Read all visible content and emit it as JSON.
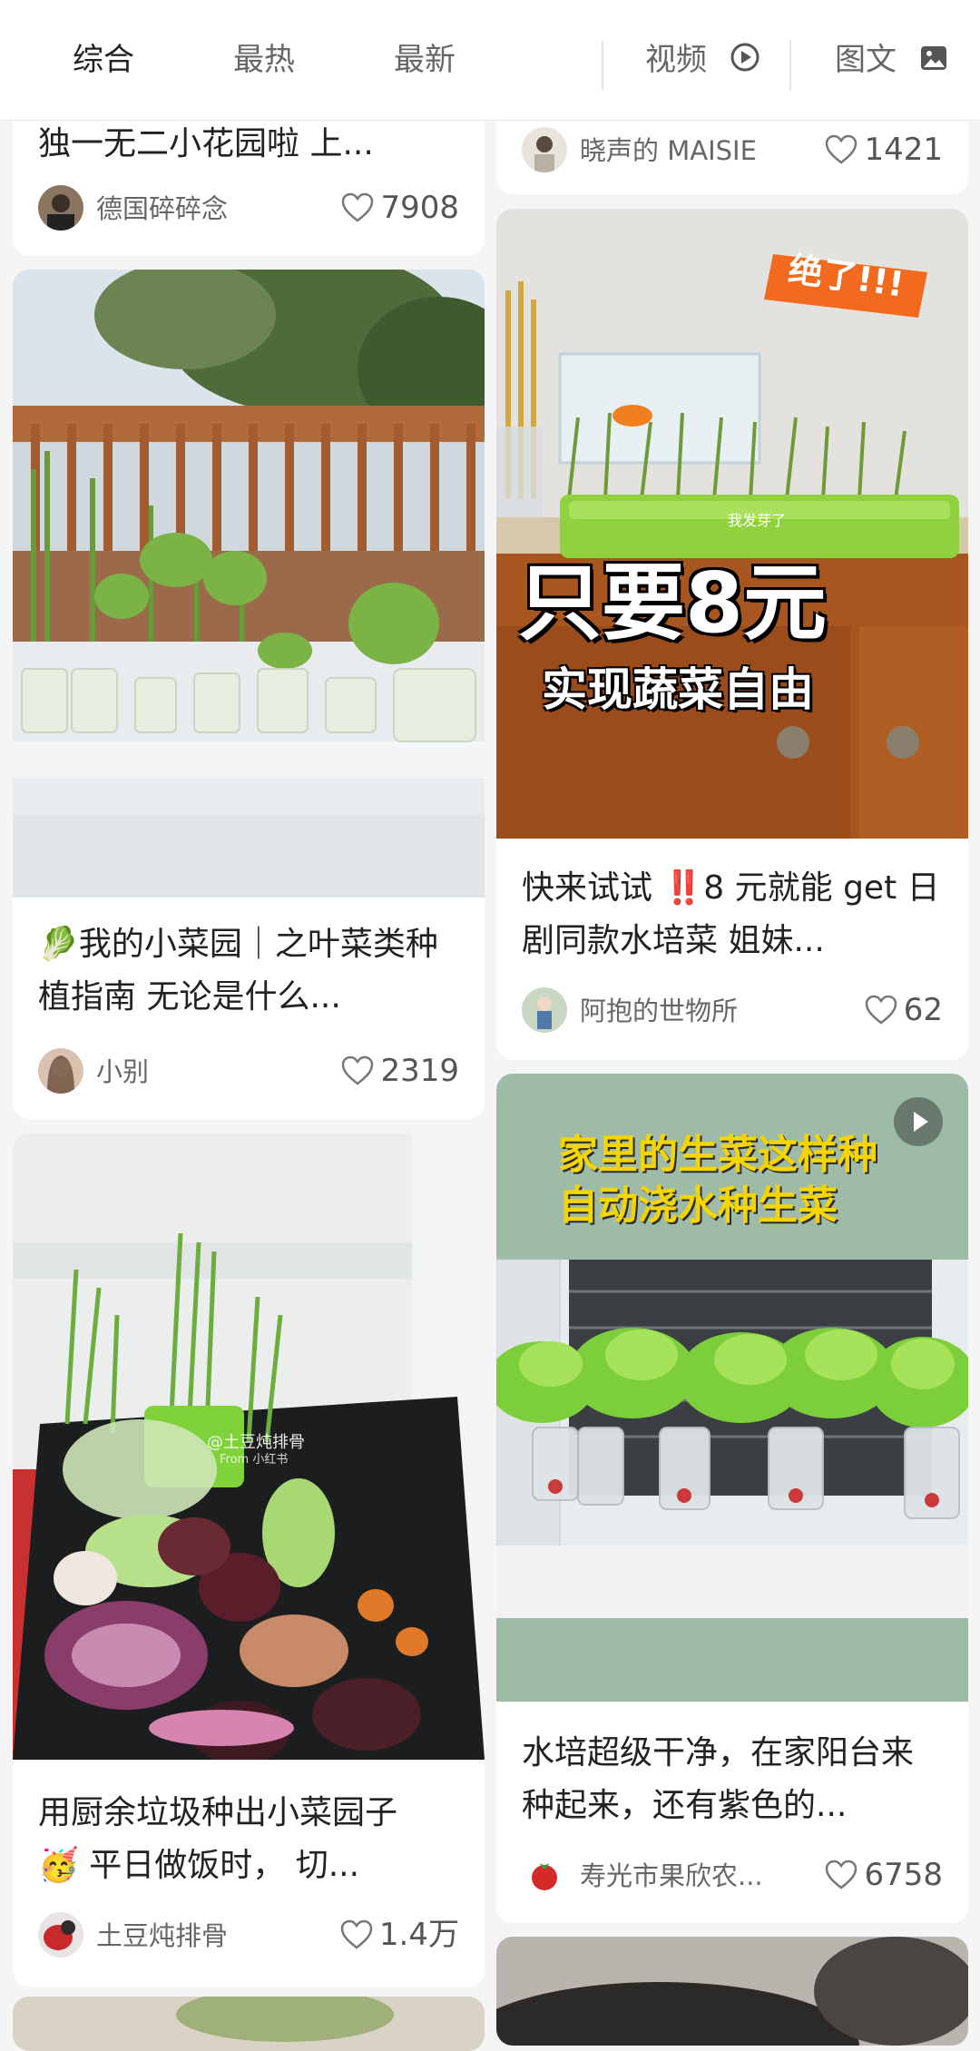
{
  "header": {
    "tabs": [
      "综合",
      "最热",
      "最新"
    ],
    "video_tab": "视频",
    "image_text_tab": "图文"
  },
  "cards": [
    {
      "title": "独一无二小花园啦 上...",
      "author": "德国碎碎念",
      "likes": "7908"
    },
    {
      "title": "",
      "author": "晓声的 MAISIE",
      "likes": "1421"
    },
    {
      "title": "我的小菜园｜之叶菜类种植指南 无论是什么...",
      "emoji": "🥬",
      "author": "小别",
      "likes": "2319"
    },
    {
      "title": "快来试试",
      "title2": "‼️8 元就能 get 日剧同款水培菜 姐妹...",
      "author": "阿抱的世物所",
      "likes": "62",
      "image_text": {
        "tag": "绝了!!!",
        "big": "只要8元",
        "sub": "实现蔬菜自由",
        "small": "我发芽了"
      }
    },
    {
      "title": "用厨余垃圾种出小菜园子",
      "title2": "平日做饭时， 切...",
      "emoji": "🥳",
      "author": "土豆炖排骨",
      "likes": "1.4万",
      "image_watermark": {
        "line1": "@土豆炖排骨",
        "line2": "From 小红书"
      }
    },
    {
      "title": "水培超级干净，在家阳台来种起来，还有紫色的...",
      "author": "寿光市果欣农...",
      "likes": "6758",
      "image_text": {
        "line1": "家里的生菜这样种",
        "line2": "自动浇水种生菜"
      }
    }
  ],
  "colors": {
    "accent_orange": "#f26a1d",
    "tray_green": "#8fd13f",
    "banner_yellow": "#f5d500",
    "teal_bg": "#9dbba6"
  }
}
